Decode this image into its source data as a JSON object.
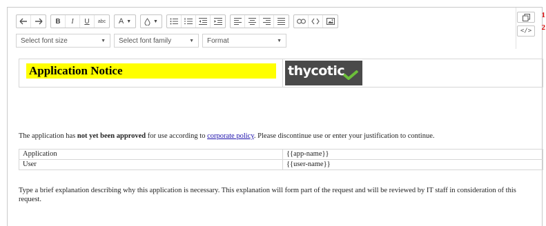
{
  "toolbar": {
    "row1": [
      {
        "id": "undo",
        "icon": "undo-icon"
      },
      {
        "id": "redo",
        "icon": "redo-icon"
      },
      {
        "id": "bold",
        "label": "B"
      },
      {
        "id": "italic",
        "label": "I"
      },
      {
        "id": "underline",
        "label": "U"
      },
      {
        "id": "strikethrough",
        "label": "abc"
      },
      {
        "id": "font-color",
        "label": "A"
      },
      {
        "id": "background-color",
        "icon": "drop-icon"
      },
      {
        "id": "bulleted-list",
        "icon": "bulleted-list-icon"
      },
      {
        "id": "numbered-list",
        "icon": "numbered-list-icon"
      },
      {
        "id": "outdent",
        "icon": "outdent-icon"
      },
      {
        "id": "indent",
        "icon": "indent-icon"
      },
      {
        "id": "align-left",
        "icon": "align-left-icon"
      },
      {
        "id": "align-center",
        "icon": "align-center-icon"
      },
      {
        "id": "align-right",
        "icon": "align-right-icon"
      },
      {
        "id": "justify",
        "icon": "justify-icon"
      },
      {
        "id": "link",
        "icon": "link-icon"
      },
      {
        "id": "unlink",
        "icon": "unlink-icon"
      },
      {
        "id": "image",
        "icon": "image-icon"
      }
    ],
    "font_size_placeholder": "Select font size",
    "font_family_placeholder": "Select font family",
    "format_label": "Format"
  },
  "side": {
    "badge1": "1",
    "badge2": "2",
    "button1_icon": "maximize-icon",
    "button2_icon": "code-view-icon"
  },
  "content": {
    "notice_title": "Application Notice",
    "logo_text": "thycotic",
    "sentence_pre": "The application has ",
    "sentence_bold": "not yet been approved",
    "sentence_mid": " for use according to ",
    "sentence_link": "corporate policy",
    "sentence_post": ". Please discontinue use or enter your justification to continue.",
    "table": [
      [
        "Application",
        "{{app-name}}"
      ],
      [
        "User",
        "{{user-name}}"
      ]
    ],
    "explanation": "Type a brief explanation describing why this application is necessary. This explanation will form part of the request and will be reviewed by IT staff in consideration of this request."
  },
  "colors": {
    "highlight": "#ffff00",
    "link": "#1a0dab",
    "badge": "#d40000",
    "logo_bg": "#4a4a4a",
    "logo_check": "#6cbf3a"
  }
}
